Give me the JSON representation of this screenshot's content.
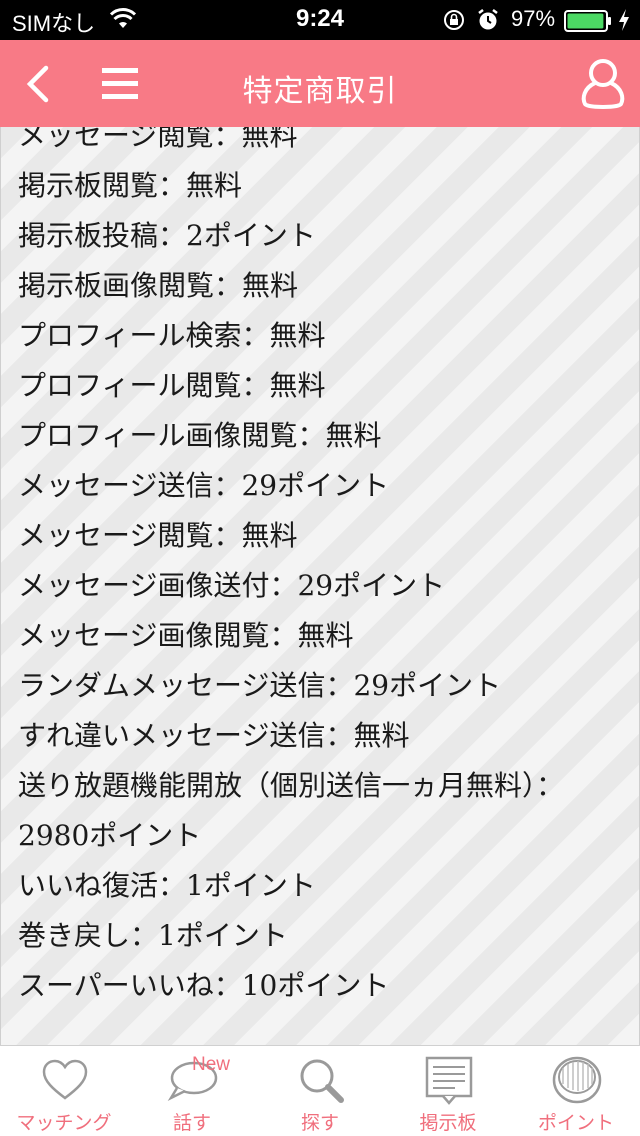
{
  "status_bar": {
    "carrier": "SIMなし",
    "time": "9:24",
    "battery_percent": "97%",
    "battery_level": 0.97
  },
  "nav": {
    "title": "特定商取引"
  },
  "content": {
    "items": [
      "メッセージ閲覧：無料",
      "掲示板閲覧：無料",
      "掲示板投稿：2ポイント",
      "掲示板画像閲覧：無料",
      "プロフィール検索：無料",
      "プロフィール閲覧：無料",
      "プロフィール画像閲覧：無料",
      "メッセージ送信：29ポイント",
      "メッセージ閲覧：無料",
      "メッセージ画像送付：29ポイント",
      "メッセージ画像閲覧：無料",
      "ランダムメッセージ送信：29ポイント",
      "すれ違いメッセージ送信：無料",
      "送り放題機能開放（個別送信一ヵ月無料）：2980ポイント",
      "いいね復活：1ポイント",
      "巻き戻し：1ポイント",
      "スーパーいいね：10ポイント"
    ]
  },
  "tab_bar": {
    "accent_color": "#f06f7d",
    "tabs": [
      {
        "label": "マッチング",
        "icon": "heart-icon"
      },
      {
        "label": "話す",
        "icon": "speech-bubble-icon",
        "badge": "New"
      },
      {
        "label": "探す",
        "icon": "search-icon"
      },
      {
        "label": "掲示板",
        "icon": "bulletin-board-icon"
      },
      {
        "label": "ポイント",
        "icon": "coin-icon"
      }
    ]
  },
  "colors": {
    "header": "#f87a86",
    "status_bar": "#000000",
    "battery": "#4cd964"
  }
}
